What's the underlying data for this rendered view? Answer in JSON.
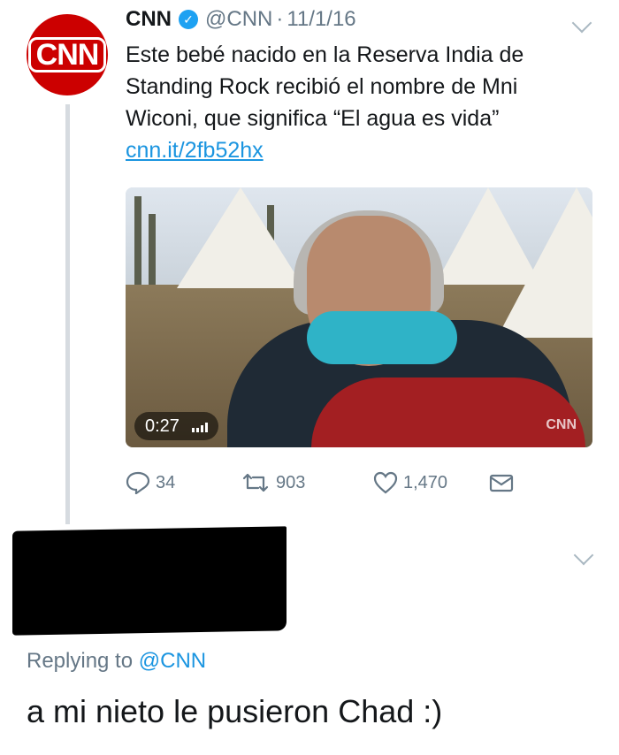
{
  "tweet": {
    "avatar_text": "CNN",
    "author_name": "CNN",
    "handle": "@CNN",
    "separator": "·",
    "date": "11/1/16",
    "text": "Este bebé nacido en la Reserva India de Standing Rock recibió el nombre de Mni Wiconi, que significa “El agua es vida”",
    "link": "cnn.it/2fb52hx",
    "video": {
      "duration": "0:27",
      "watermark": "CNN"
    },
    "actions": {
      "replies": "34",
      "retweets": "903",
      "likes": "1,470"
    }
  },
  "reply": {
    "replying_prefix": "Replying to",
    "replying_to": "@CNN",
    "text": "a mi nieto le pusieron Chad :)"
  },
  "colors": {
    "brand_red": "#cc0000",
    "link_blue": "#1b95e0",
    "verified_blue": "#1da1f2",
    "muted": "#657786"
  },
  "icons": [
    "verified-badge-icon",
    "chevron-down-icon",
    "reply-icon",
    "retweet-icon",
    "heart-icon",
    "direct-message-icon",
    "audio-bars-icon"
  ]
}
